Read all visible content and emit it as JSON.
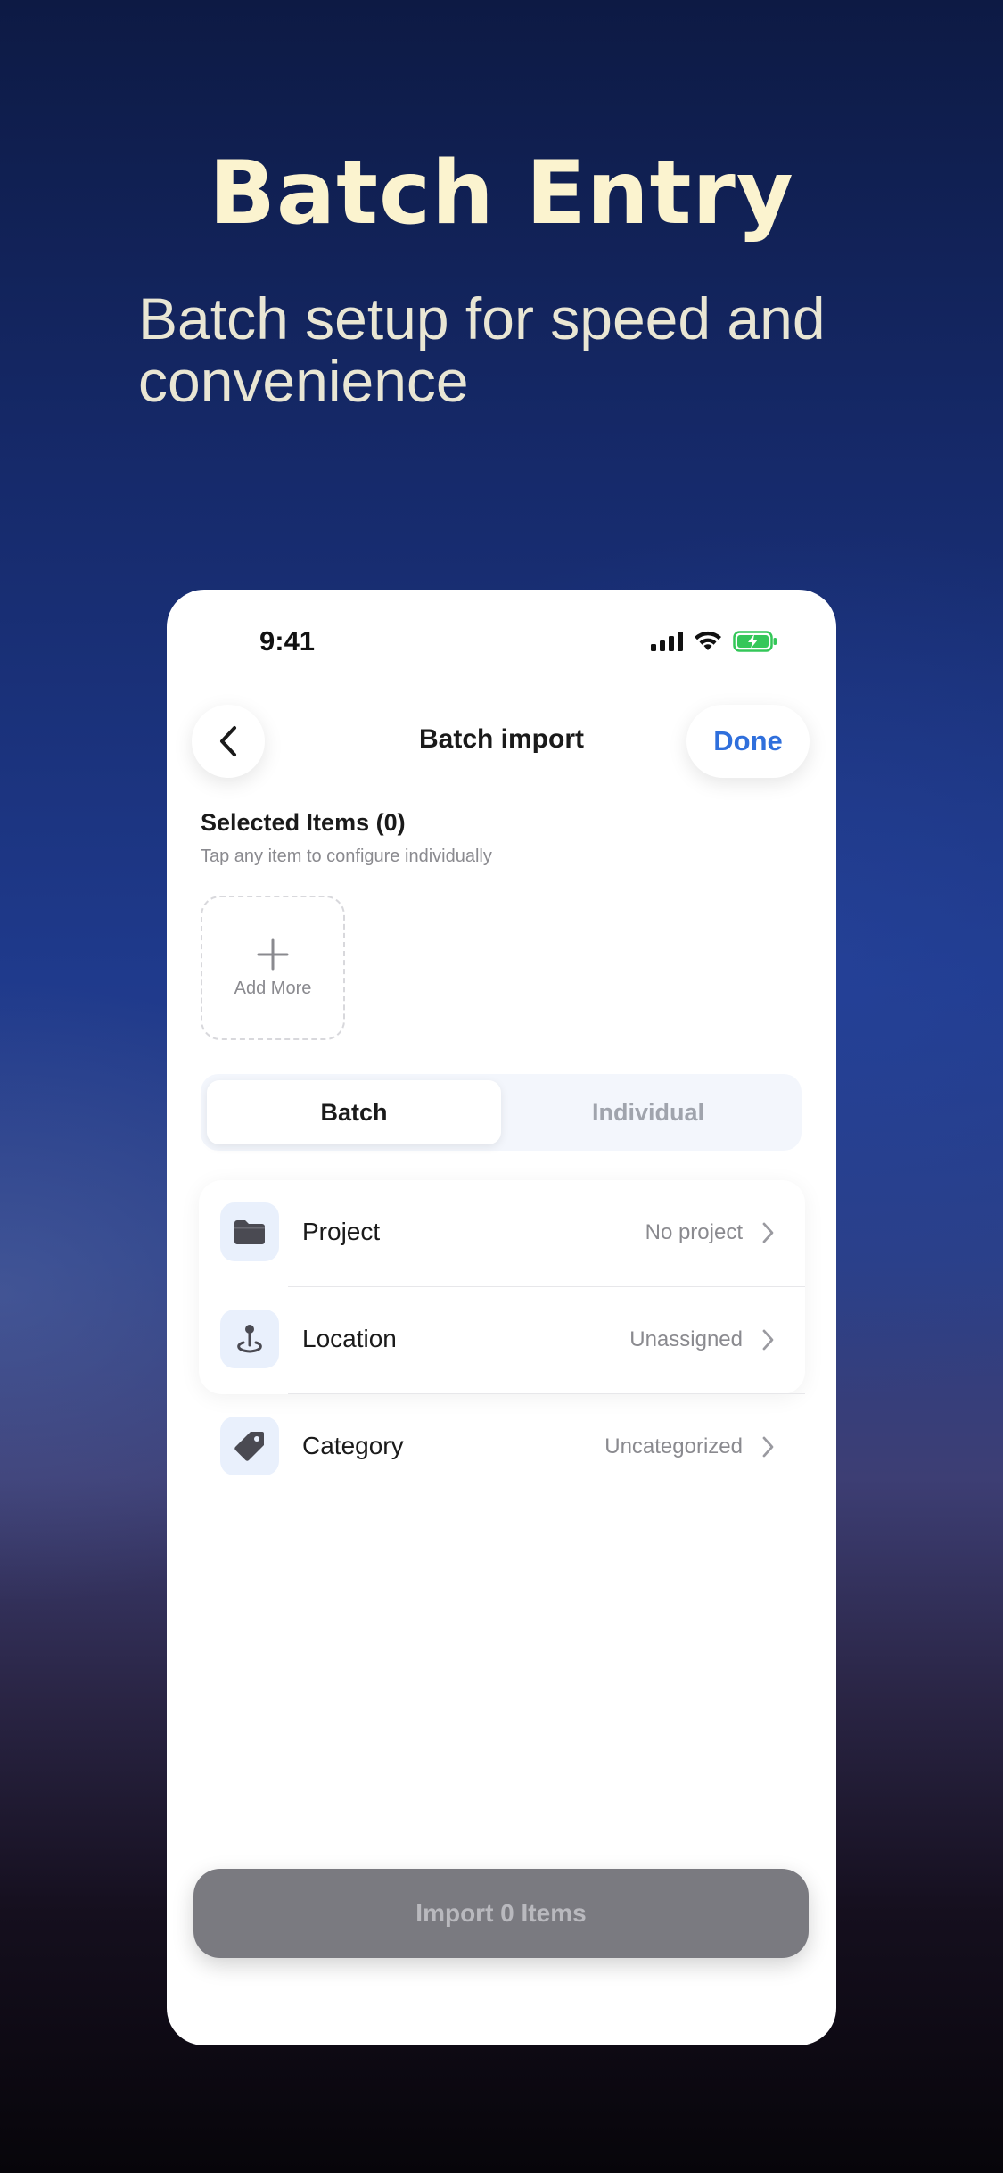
{
  "promo": {
    "title": "Batch Entry",
    "subtitle": "Batch setup for speed and convenience"
  },
  "status_bar": {
    "time": "9:41",
    "icons": [
      "cellular-signal-icon",
      "wifi-icon",
      "battery-charging-icon"
    ],
    "battery_color": "#34c759"
  },
  "nav": {
    "back_icon": "chevron-left-icon",
    "title": "Batch import",
    "done_label": "Done",
    "accent_color": "#2f6fdc"
  },
  "selected": {
    "title": "Selected Items (0)",
    "hint": "Tap any item to configure individually",
    "add_more_label": "Add More",
    "add_icon": "plus-icon"
  },
  "segments": {
    "batch": "Batch",
    "individual": "Individual",
    "active": "Batch"
  },
  "settings": [
    {
      "icon": "folder-icon",
      "label": "Project",
      "value": "No project"
    },
    {
      "icon": "location-pin-icon",
      "label": "Location",
      "value": "Unassigned"
    },
    {
      "icon": "tag-icon",
      "label": "Category",
      "value": "Uncategorized"
    }
  ],
  "import_button": {
    "label": "Import 0 Items"
  }
}
